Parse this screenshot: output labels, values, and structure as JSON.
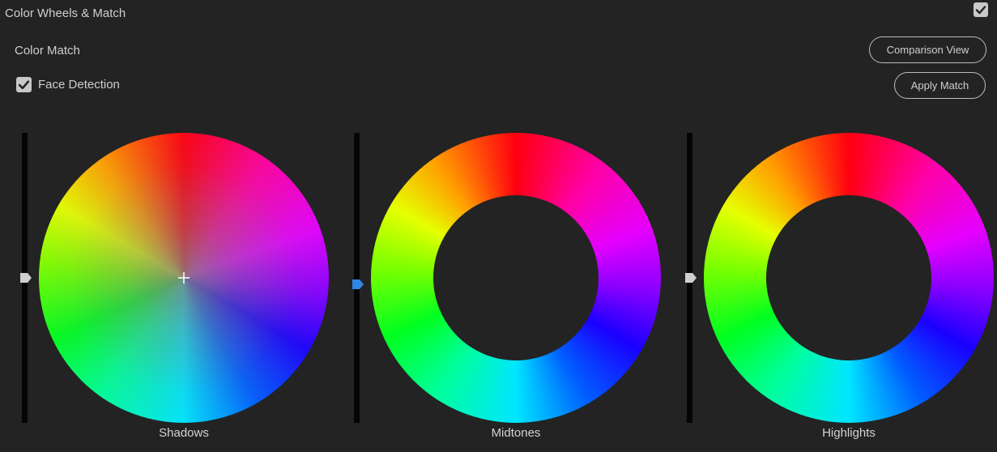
{
  "section": {
    "title": "Color Wheels & Match",
    "enabled": true,
    "toggle_icon": "checkmark-icon"
  },
  "color_match": {
    "title": "Color Match",
    "face_detection": {
      "label": "Face Detection",
      "checked": true
    },
    "comparison_view_label": "Comparison View",
    "apply_match_label": "Apply Match"
  },
  "wheels": [
    {
      "label": "Shadows",
      "style": "filled",
      "slider_active": false
    },
    {
      "label": "Midtones",
      "style": "ring",
      "slider_active": true
    },
    {
      "label": "Highlights",
      "style": "ring",
      "slider_active": false
    }
  ],
  "colors": {
    "background": "#232323",
    "text": "#cfcfcf",
    "track": "#050505",
    "handle_inactive": "#cfcfcf",
    "handle_active": "#2f86e6"
  }
}
